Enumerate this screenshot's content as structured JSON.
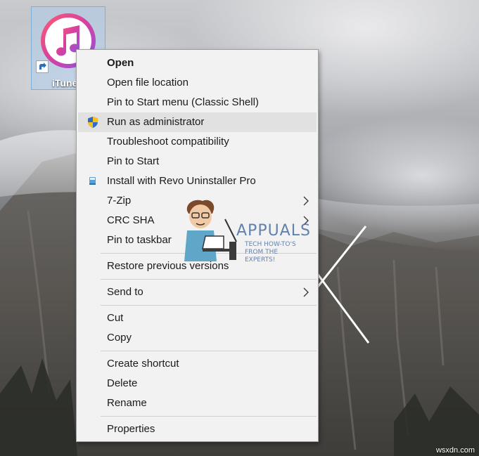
{
  "desktop": {
    "icon_label": "iTunes",
    "icon_name": "itunes-icon",
    "watermark_title": "APPUALS",
    "watermark_subtitle": "TECH HOW-TO'S FROM THE EXPERTS!",
    "site_mark": "wsxdn.com"
  },
  "menu": {
    "open": "Open",
    "open_file_location": "Open file location",
    "pin_start_classic": "Pin to Start menu (Classic Shell)",
    "run_as_admin": "Run as administrator",
    "troubleshoot": "Troubleshoot compatibility",
    "pin_to_start": "Pin to Start",
    "revo": "Install with Revo Uninstaller Pro",
    "seven_zip": "7-Zip",
    "crc_sha": "CRC SHA",
    "pin_taskbar": "Pin to taskbar",
    "restore": "Restore previous versions",
    "send_to": "Send to",
    "cut": "Cut",
    "copy": "Copy",
    "create_shortcut": "Create shortcut",
    "delete": "Delete",
    "rename": "Rename",
    "properties": "Properties",
    "hovered_item": "Run as administrator"
  },
  "colors": {
    "menu_bg": "#f2f2f2",
    "hover_bg": "#e1e1e1",
    "selection_fill": "#adccea"
  }
}
